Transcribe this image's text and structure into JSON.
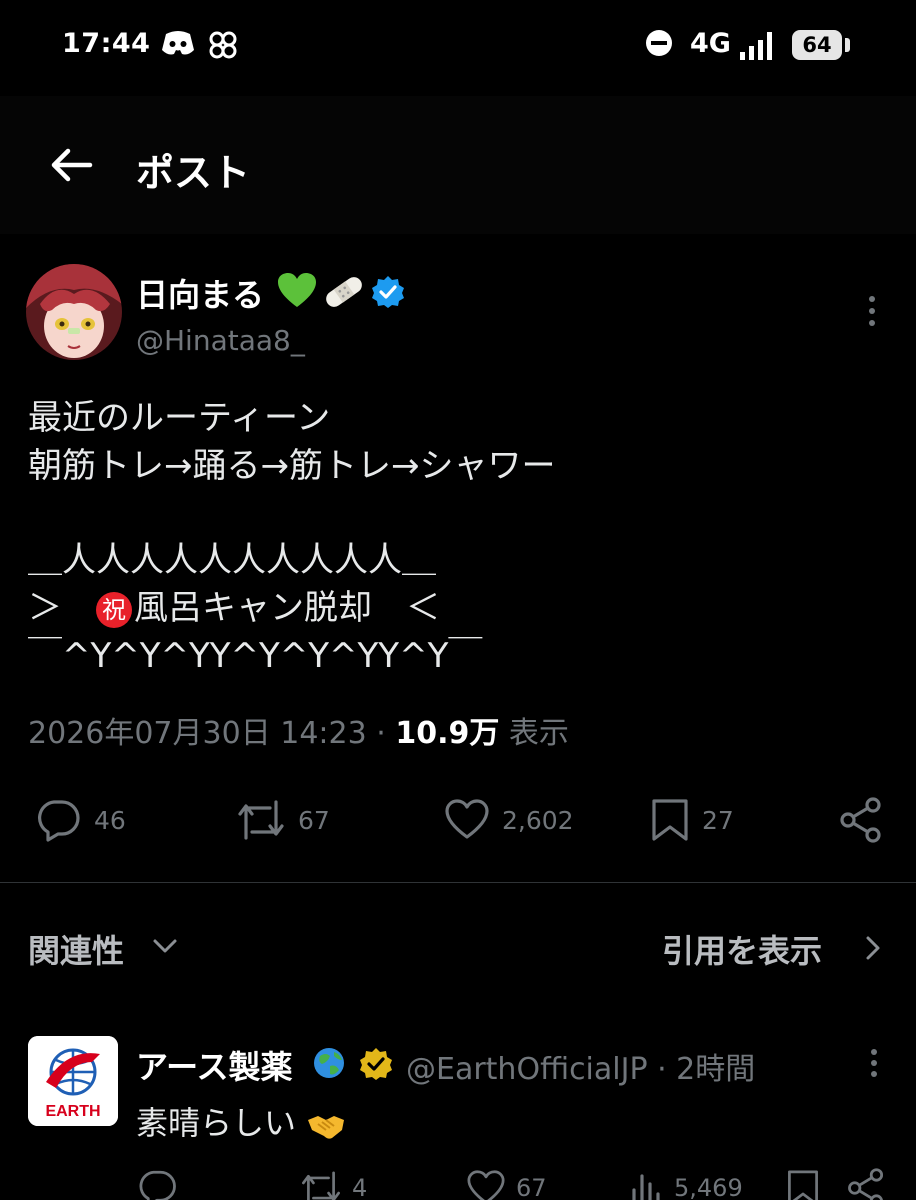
{
  "status_bar": {
    "time": "17:44",
    "network": "4G",
    "battery": "64",
    "icons": [
      "discord-icon",
      "pinwheel-icon",
      "do-not-disturb-icon",
      "signal-icon"
    ]
  },
  "header": {
    "title": "ポスト",
    "back_icon": "arrow-left-icon"
  },
  "post": {
    "author_name": "日向まる",
    "author_name_emoji": [
      "green-heart-icon",
      "bandage-icon",
      "verified-blue-icon"
    ],
    "handle": "@Hinataa8_",
    "lines": [
      "最近のルーティーン",
      "朝筋トレ→踊る→筋トレ→シャワー",
      "",
      "＿人人人人人人人人人人＿",
      "＞　🉐風呂キャン脱却　＜",
      "￣^Y^Y^YY^Y^Y^YY^Y￣"
    ],
    "line4_prefix": "＞　",
    "line4_emoji": "祝",
    "line4_text": "風呂キャン脱却　＜",
    "date": "2026年07月30日 14:23",
    "separator": "·",
    "views": "10.9万",
    "views_label": "表示",
    "actions": {
      "replies": "46",
      "reposts": "67",
      "likes": "2,602",
      "bookmarks": "27"
    }
  },
  "related": {
    "label": "関連性",
    "quotes_label": "引用を表示"
  },
  "reply": {
    "name": "アース製薬",
    "name_emoji": [
      "globe-icon",
      "verified-gold-icon"
    ],
    "handle_line": "@EarthOfficialJP · 2時間",
    "avatar_text": "EARTH",
    "text": "素晴らしい",
    "text_emoji": "handshake-icon",
    "actions": {
      "replies": "",
      "reposts": "4",
      "likes": "67",
      "views": "5,469"
    }
  },
  "colors": {
    "background": "#000000",
    "text": "#e7e9ea",
    "muted": "#71767b",
    "verified_blue": "#1d9bf0",
    "verified_gold": "#e2b719",
    "earth_red": "#d7001c"
  }
}
